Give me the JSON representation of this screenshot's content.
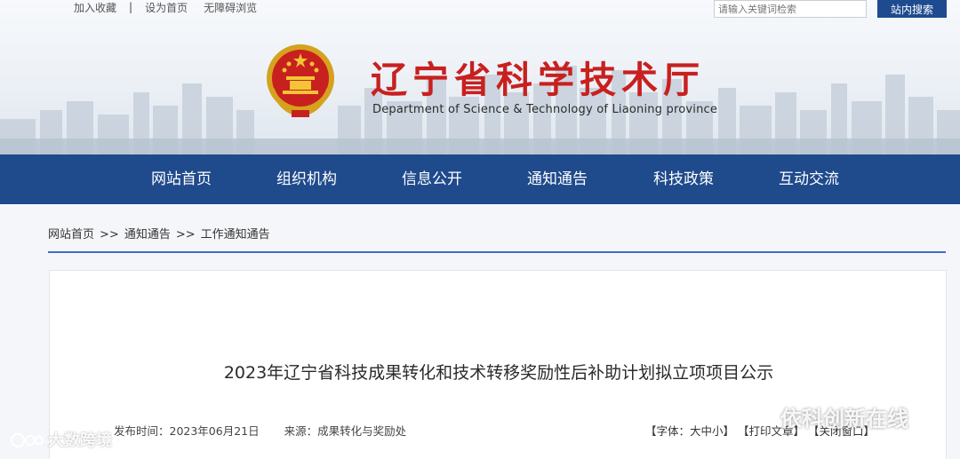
{
  "toplinks": {
    "favorite": "加入收藏",
    "sep": "|",
    "homepage": "设为首页",
    "accessibility": "无障碍浏览"
  },
  "search": {
    "placeholder": "请输入关键词检索",
    "button": "站内搜索"
  },
  "header": {
    "title": "辽宁省科学技术厅",
    "subtitle": "Department of Science & Technology of Liaoning province",
    "emblem_icon": "national-emblem-icon"
  },
  "nav": {
    "items": [
      "网站首页",
      "组织机构",
      "信息公开",
      "通知通告",
      "科技政策",
      "互动交流"
    ]
  },
  "breadcrumb": {
    "items": [
      "网站首页",
      "通知通告",
      "工作通知通告"
    ],
    "separator": ">>"
  },
  "article": {
    "title": "2023年辽宁省科技成果转化和技术转移奖励性后补助计划拟立项项目公示",
    "publish_time": "发布时间：2023年06月21日",
    "source": "来源：成果转化与奖励处",
    "font_size_label": "【字体：大中小】",
    "print_label": "【打印文章】",
    "close_label": "【关闭窗口】"
  },
  "watermarks": {
    "left": "大数跨境",
    "right": "依科创新在线"
  },
  "colors": {
    "nav_bg": "#1f4a8c",
    "title_red": "#c8201f",
    "accent_line": "#3d6fc0",
    "search_btn": "#1e4b8f"
  }
}
